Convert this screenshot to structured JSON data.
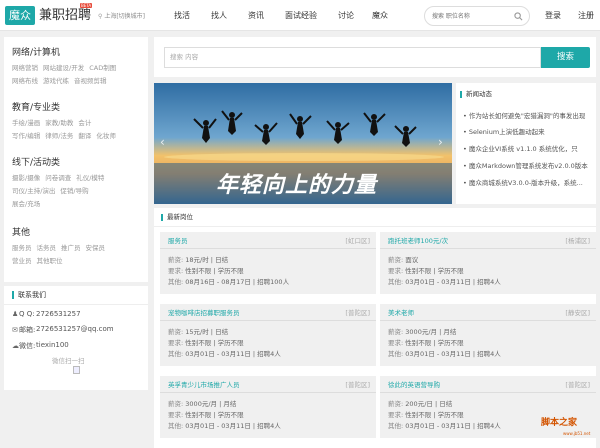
{
  "header": {
    "logo_box": "魔众",
    "logo_text": "兼职招聘",
    "logo_tag": "BETA",
    "city": "上海[切换城市]",
    "nav": [
      "找活",
      "找人",
      "资讯",
      "面试经验",
      "讨论",
      "魔众"
    ],
    "search_placeholder": "搜索 职位名称",
    "login": "登录",
    "register": "注册"
  },
  "sidebar": {
    "categories": [
      {
        "title": "网络/计算机",
        "rows": [
          [
            "网络营销",
            "网站建设/开发",
            "CAD制图"
          ],
          [
            "网络布线",
            "游戏代练",
            "音视频剪辑"
          ]
        ]
      },
      {
        "title": "教育/专业类",
        "rows": [
          [
            "手绘/漫画",
            "家教/助教",
            "会计"
          ],
          [
            "写作/编辑",
            "律师/法务",
            "翻译",
            "化妆师"
          ]
        ]
      },
      {
        "title": "线下/活动类",
        "rows": [
          [
            "摄影/摄像",
            "问卷调查",
            "礼仪/模特"
          ],
          [
            "司仪/主持/演出",
            "促销/导购"
          ],
          [
            "展会/充场"
          ]
        ]
      },
      {
        "title": "其他",
        "rows": [
          [
            "服务员",
            "话务员",
            "推广员",
            "安保员"
          ],
          [
            "营业员",
            "其他职位"
          ]
        ]
      }
    ]
  },
  "contact": {
    "title": "联系我们",
    "qq_label": "Q Q:",
    "qq": "2726531257",
    "email_label": "邮箱:",
    "email": "2726531257@qq.com",
    "wechat_label": "微信:",
    "wechat": "tiexin100",
    "qr_label": "微信扫一扫"
  },
  "main_search": {
    "placeholder": "搜索 内容",
    "button": "搜索"
  },
  "banner": {
    "slogan": "年轻向上的力量",
    "prev": "‹",
    "next": "›"
  },
  "news": {
    "title": "新闻动态",
    "items": [
      "作为站长如何避免\"宏猎漏洞\"的事发出现",
      "Selenium上演低趣动起来",
      "魔众企业VI系统 v1.1.0 系统优化，只",
      "魔众Markdown管理系统发布v2.0.0版本",
      "魔众商城系统V3.0.0-版本升级，系统..."
    ]
  },
  "jobs": {
    "title": "最新岗位",
    "labels": {
      "salary": "薪资:",
      "require": "要求:",
      "other": "其他:"
    },
    "cards": [
      {
        "title": "服务员",
        "area": "[虹口区]",
        "salary": "18元/时 | 日结",
        "require": "性别不限 | 学历不限",
        "other": "08月16日 - 08月17日 | 招聘100人"
      },
      {
        "title": "跑托班老师100元/次",
        "area": "[杨浦区]",
        "salary": "面议",
        "require": "性别不限 | 学历不限",
        "other": "03月01日 - 03月11日 | 招聘4人"
      },
      {
        "title": "宠物咖啡店招募职服务员",
        "area": "[普陀区]",
        "salary": "15元/时 | 日结",
        "require": "性别不限 | 学历不限",
        "other": "03月01日 - 03月11日 | 招聘4人"
      },
      {
        "title": "美术老师",
        "area": "[静安区]",
        "salary": "3000元/月 | 月结",
        "require": "性别不限 | 学历不限",
        "other": "03月01日 - 03月11日 | 招聘4人"
      },
      {
        "title": "英孚青少儿市场推广人员",
        "area": "[普陀区]",
        "salary": "3000元/月 | 月结",
        "require": "性别不限 | 学历不限",
        "other": "03月01日 - 03月11日 | 招聘4人"
      },
      {
        "title": "徐此的英语营导购",
        "area": "[普陀区]",
        "salary": "200元/日 | 日结",
        "require": "性别不限 | 学历不限",
        "other": "03月01日 - 03月11日 | 招聘4人"
      }
    ]
  },
  "watermark": {
    "text": "脚本之家",
    "sub": "www.jb51.net"
  },
  "colors": {
    "accent": "#1ea8a8",
    "tag": "#e74c3c",
    "sea": "#2a6a9e",
    "sunset": "#f2c26b"
  }
}
